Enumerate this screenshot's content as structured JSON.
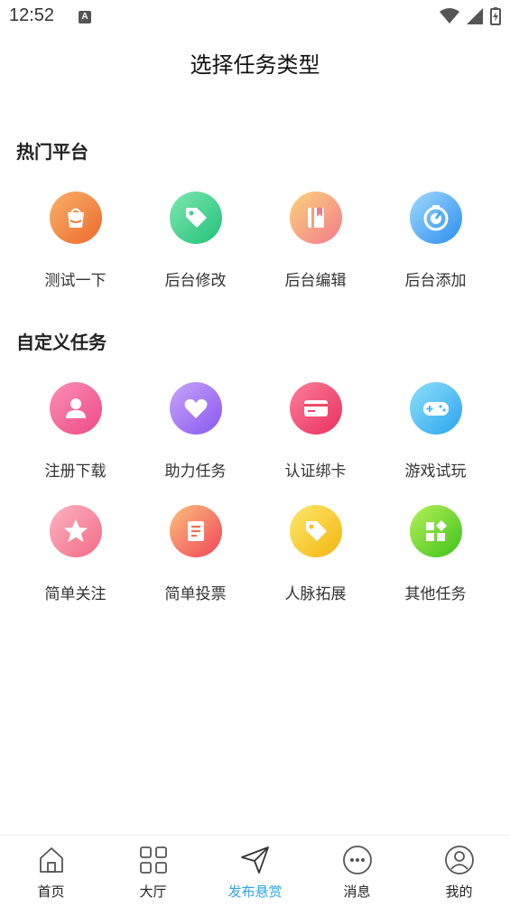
{
  "status_bar": {
    "time": "12:52",
    "notification_badge": "A"
  },
  "header": {
    "title": "选择任务类型"
  },
  "sections": [
    {
      "title": "热门平台",
      "items": [
        {
          "label": "测试一下",
          "icon": "bag-icon"
        },
        {
          "label": "后台修改",
          "icon": "tag-icon"
        },
        {
          "label": "后台编辑",
          "icon": "book-icon"
        },
        {
          "label": "后台添加",
          "icon": "dial-icon"
        }
      ]
    },
    {
      "title": "自定义任务",
      "items": [
        {
          "label": "注册下载",
          "icon": "user-icon"
        },
        {
          "label": "助力任务",
          "icon": "heart-icon"
        },
        {
          "label": "认证绑卡",
          "icon": "card-icon"
        },
        {
          "label": "游戏试玩",
          "icon": "gamepad-icon"
        },
        {
          "label": "简单关注",
          "icon": "star-icon"
        },
        {
          "label": "简单投票",
          "icon": "document-icon"
        },
        {
          "label": "人脉拓展",
          "icon": "tag-icon"
        },
        {
          "label": "其他任务",
          "icon": "grid-icon"
        }
      ]
    }
  ],
  "tab_bar": {
    "active": "发布悬赏",
    "tabs": [
      {
        "label": "首页",
        "icon": "home-icon"
      },
      {
        "label": "大厅",
        "icon": "apps-icon"
      },
      {
        "label": "发布悬赏",
        "icon": "send-icon"
      },
      {
        "label": "消息",
        "icon": "chat-icon"
      },
      {
        "label": "我的",
        "icon": "profile-icon"
      }
    ]
  },
  "colors": {
    "accent": "#2fa5e8",
    "orange": "#f0793a",
    "green": "#3dcf8a",
    "peach": "#f5a07a",
    "blue": "#3aa2f0",
    "pink": "#f0578f",
    "purple": "#9b6cf0",
    "red_pink": "#f04a6c",
    "cyan": "#4ab9f0",
    "rose": "#f7859a",
    "coral": "#f56a4a",
    "yellow": "#f5c518",
    "lime": "#5fd01c"
  }
}
